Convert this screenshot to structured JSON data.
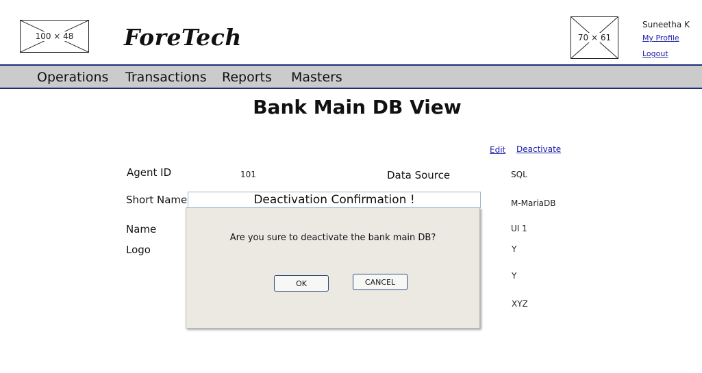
{
  "header": {
    "logo_placeholder": "100 × 48",
    "brand": "ForeTech",
    "avatar_placeholder": "70 × 61",
    "user_name": "Suneetha K",
    "profile_link": "My Profile",
    "logout_link": "Logout"
  },
  "nav": {
    "items": [
      {
        "label": "Operations"
      },
      {
        "label": "Transactions"
      },
      {
        "label": "Reports"
      },
      {
        "label": "Masters"
      }
    ]
  },
  "page": {
    "title": "Bank Main DB View",
    "edit_link": "Edit",
    "deactivate_link": "Deactivate"
  },
  "fields": {
    "agent_id_label": "Agent ID",
    "agent_id_value": "101",
    "short_name_label": "Short Name",
    "name_label": "Name",
    "logo_label": "Logo",
    "data_source_label": "Data Source",
    "right_values": [
      "SQL",
      "M-MariaDB",
      "UI 1",
      "Y",
      "Y",
      "XYZ"
    ]
  },
  "modal": {
    "title": "Deactivation Confirmation !",
    "message": "Are you sure to deactivate the bank main DB?",
    "ok_label": "OK",
    "cancel_label": "CANCEL"
  }
}
